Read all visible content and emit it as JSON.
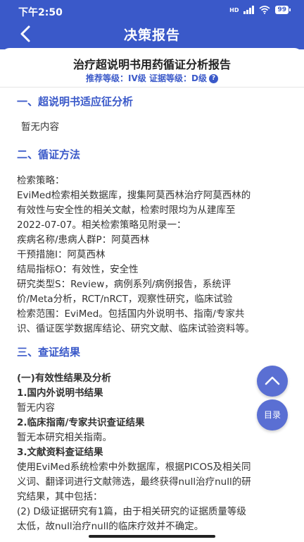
{
  "status": {
    "time": "下午2:50",
    "battery": "99"
  },
  "header": {
    "title": "决策报告"
  },
  "report": {
    "title": "治疗超说明书用药循证分析报告",
    "grade_label": "推荐等级：IV级 证据等级：D级"
  },
  "sections": {
    "s1": {
      "heading": "一、超说明书适应征分析",
      "text": "暂无内容"
    },
    "s2": {
      "heading": "二、循证方法",
      "lines": [
        "检索策略：",
        "EviMed检索相关数据库，搜集阿莫西林治疗阿莫西林的",
        "有效性与安全性的相关文献，检索时限均为从建库至",
        "2022-07-07。相关检索策略见附录一：",
        "疾病名称/患病人群P：阿莫西林",
        "干预措施I：阿莫西林",
        "结局指标O：有效性，安全性",
        "研究类型S：Review，病例系列/病例报告，系统评",
        "价/Meta分析，RCT/nRCT，观察性研究，临床试验",
        "检索范围：EviMed。包括国内外说明书、指南/专家共",
        "识、循证医学数据库结论、研究文献、临床试验资料等。"
      ]
    },
    "s3": {
      "heading": "三、查证结果",
      "lines": [
        "(一)有效性结果及分析",
        "1.国内外说明书结果",
        "暂无内容",
        "2.临床指南/专家共识查证结果",
        "暂无本研究相关指南。",
        "3.文献资料查证结果",
        "使用EviMed系统检索中外数据库，根据PICOS及相关同",
        "义词、翻译词进行文献筛选，最终获得null治疗null的研",
        "究结果，其中包括：",
        "(2) D级证据研究有1篇，由于相关研究的证据质量等级",
        "太低，故null治疗null的临床疗效并不确定。"
      ]
    }
  },
  "floating": {
    "top_icon": "chevron-up-icon",
    "toc_label": "目录"
  },
  "colors": {
    "primary": "#3a59c9",
    "float_btn": "#5a6fd3"
  }
}
